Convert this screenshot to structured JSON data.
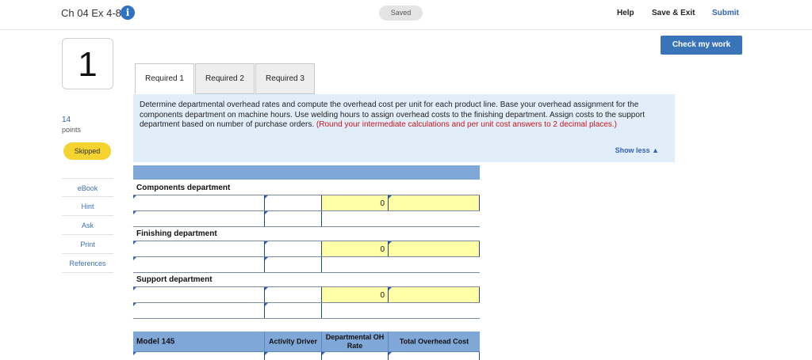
{
  "header": {
    "title": "Ch 04 Ex 4-8",
    "info_icon": "info-icon",
    "saved_label": "Saved",
    "help_label": "Help",
    "save_exit_label": "Save & Exit",
    "submit_label": "Submit",
    "check_label": "Check my work"
  },
  "question": {
    "number": "1",
    "points_value": "14",
    "points_label": "points",
    "status": "Skipped"
  },
  "side_links": [
    "eBook",
    "Hint",
    "Ask",
    "Print",
    "References"
  ],
  "tabs": [
    "Required 1",
    "Required 2",
    "Required 3"
  ],
  "instructions": {
    "text": "Determine departmental overhead rates and compute the overhead cost per unit for each product line. Base your overhead assignment for the components department on machine hours. Use welding hours to assign overhead costs to the finishing department. Assign costs to the support department based on number of purchase orders.",
    "note": "(Round your intermediate calculations and per unit cost answers to 2 decimal places.)",
    "show_less": "Show less ▲"
  },
  "table": {
    "sections": [
      {
        "label": "Components department",
        "total": "0"
      },
      {
        "label": "Finishing department",
        "total": "0"
      },
      {
        "label": "Support department",
        "total": "0"
      }
    ],
    "model_header": {
      "model": "Model 145",
      "activity_driver": "Activity Driver",
      "oh_rate": "Departmental OH Rate",
      "total_cost": "Total Overhead Cost"
    }
  },
  "colors": {
    "accent": "#3a74b8",
    "header_blue": "#7fa8d9",
    "input_yellow": "#ffffa8",
    "panel_blue": "#e1eefa",
    "skipped_yellow": "#f5d331",
    "note_red": "#c4161c"
  }
}
